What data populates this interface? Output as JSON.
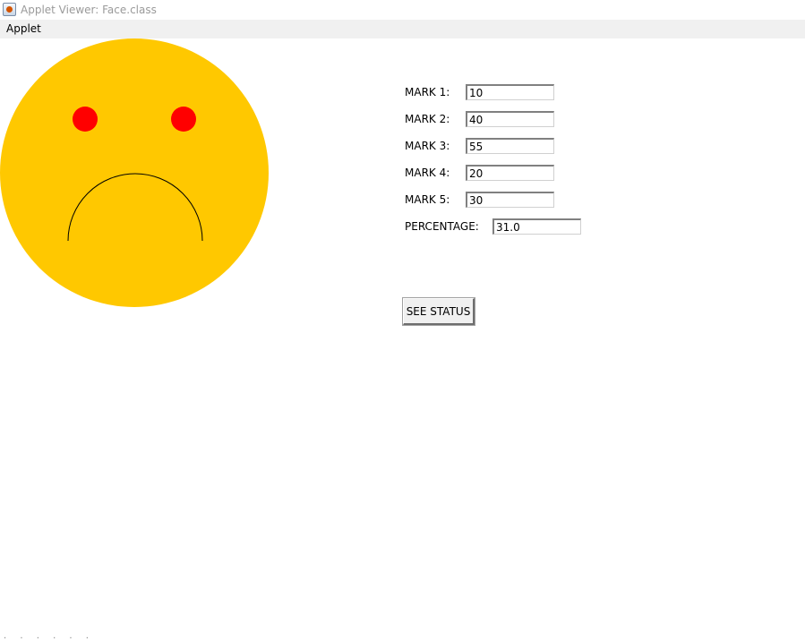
{
  "window": {
    "title": "Applet Viewer: Face.class",
    "icon": "java-applet-icon"
  },
  "menubar": {
    "items": [
      {
        "label": "Applet"
      }
    ]
  },
  "face": {
    "expression": "sad",
    "face_color": "#ffc800",
    "eye_color": "#ff0000",
    "mouth_color": "#000000"
  },
  "form": {
    "marks": [
      {
        "label": "MARK 1:",
        "value": "10"
      },
      {
        "label": "MARK 2:",
        "value": "40"
      },
      {
        "label": "MARK 3:",
        "value": "55"
      },
      {
        "label": "MARK 4:",
        "value": "20"
      },
      {
        "label": "MARK 5:",
        "value": "30"
      }
    ],
    "percentage": {
      "label": "PERCENTAGE:",
      "value": "31.0"
    },
    "see_status_label": "SEE STATUS"
  },
  "statusbar": {
    "text": ". . . . . ."
  }
}
